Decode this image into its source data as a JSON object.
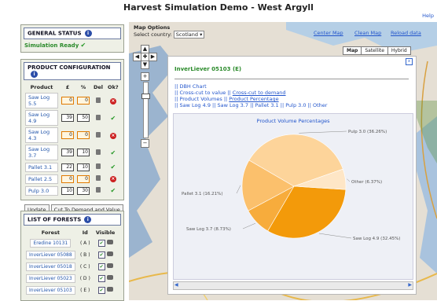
{
  "app": {
    "title": "Harvest Simulation Demo - West Argyll",
    "help": "Help"
  },
  "general_status": {
    "heading": "GENERAL STATUS",
    "status": "Simulation Ready"
  },
  "product_config": {
    "heading": "PRODUCT CONFIGURATION",
    "columns": [
      "Product",
      "£",
      "%",
      "Del",
      "Ok?"
    ],
    "rows": [
      {
        "name": "Saw Log 5.5",
        "price": "0",
        "pct": "0",
        "ok": "x"
      },
      {
        "name": "Saw Log 4.9",
        "price": "39",
        "pct": "50",
        "ok": "tick"
      },
      {
        "name": "Saw Log 4.3",
        "price": "0",
        "pct": "0",
        "ok": "x"
      },
      {
        "name": "Saw Log 3.7",
        "price": "39",
        "pct": "10",
        "ok": "tick"
      },
      {
        "name": "Pallet 3.1",
        "price": "22",
        "pct": "10",
        "ok": "tick"
      },
      {
        "name": "Pallet 2.5",
        "price": "0",
        "pct": "0",
        "ok": "x"
      },
      {
        "name": "Pulp 3.0",
        "price": "10",
        "pct": "30",
        "ok": "tick"
      }
    ],
    "update_label": "Update",
    "cut_label": "Cut To Demand and Value"
  },
  "forests": {
    "heading": "LIST OF FORESTS",
    "columns": [
      "Forest",
      "Id",
      "Visible"
    ],
    "rows": [
      {
        "name": "Eredine 10131",
        "id": "( A )"
      },
      {
        "name": "InverLiever 05088",
        "id": "( B )"
      },
      {
        "name": "InverLiever 05018",
        "id": "( C )"
      },
      {
        "name": "InverLiever 05023",
        "id": "( D )"
      },
      {
        "name": "InverLiever 05103",
        "id": "( E )"
      }
    ]
  },
  "map": {
    "options_title": "Map Options",
    "select_country_label": "Select country:",
    "country": "Scotland",
    "links": [
      "Center Map",
      "Clean Map",
      "Reload data"
    ],
    "types": [
      "Map",
      "Satellite",
      "Hybrid"
    ]
  },
  "popup": {
    "title": "InverLiever 05103 (E)",
    "links": [
      [
        "DBH Chart"
      ],
      [
        "Cross-cut to value",
        "Cross-cut to demand"
      ],
      [
        "Product Volumes",
        "Product Percentage"
      ],
      [
        "Saw Log 4.9",
        "Saw Log 3.7",
        "Pallet 3.1",
        "Pulp 3.0",
        "Other"
      ]
    ],
    "close": "x"
  },
  "chart_data": {
    "type": "pie",
    "title": "Product Volume Percentages",
    "slices": [
      {
        "label": "Saw Log 4.9 (32.45%)",
        "value": 32.45,
        "color": "#f39a0a"
      },
      {
        "label": "Saw Log 3.7 (8.73%)",
        "value": 8.73,
        "color": "#f7ac3c"
      },
      {
        "label": "Pallet 3.1 (16.21%)",
        "value": 16.21,
        "color": "#fbc06c"
      },
      {
        "label": "Pulp 3.0 (36.26%)",
        "value": 36.26,
        "color": "#fdd49a"
      },
      {
        "label": "Other (6.37%)",
        "value": 6.37,
        "color": "#fee6c6"
      }
    ]
  }
}
